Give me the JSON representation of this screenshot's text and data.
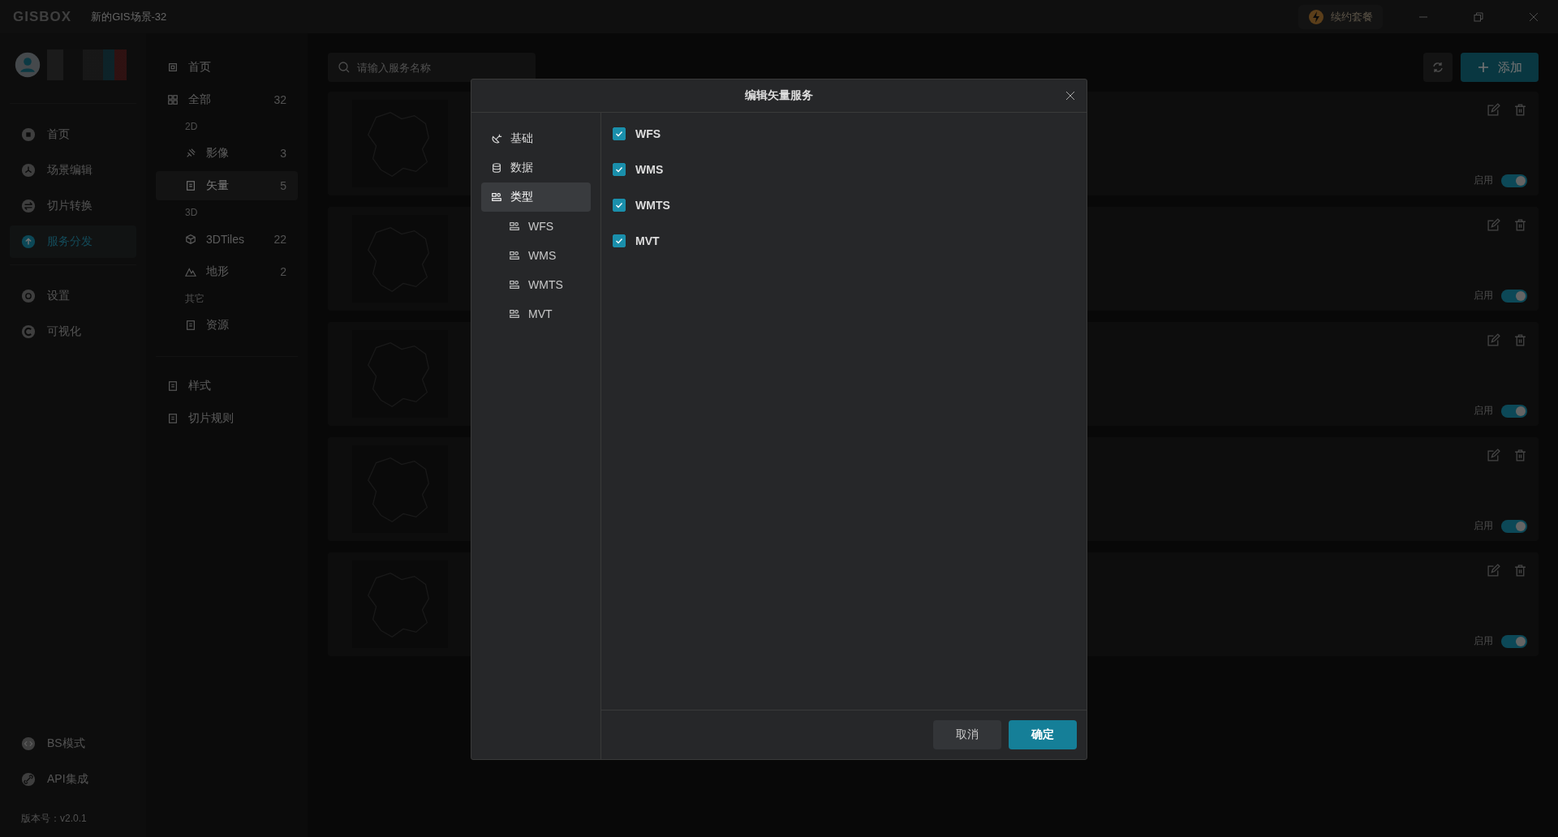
{
  "title_bar": {
    "logo": "GISBOX",
    "scene_title": "新的GIS场景-32",
    "renew_button": "续约套餐"
  },
  "nav": {
    "items": [
      {
        "label": "首页",
        "selected": false
      },
      {
        "label": "场景编辑",
        "selected": false
      },
      {
        "label": "切片转换",
        "selected": false
      },
      {
        "label": "服务分发",
        "selected": true
      }
    ],
    "secondary_items": [
      {
        "label": "设置"
      },
      {
        "label": "可视化"
      }
    ],
    "bottom_items": [
      {
        "label": "BS模式"
      },
      {
        "label": "API集成"
      }
    ],
    "version": "版本号：v2.0.1"
  },
  "categories": {
    "top": [
      {
        "label": "首页"
      },
      {
        "label": "全部",
        "count": "32"
      }
    ],
    "groups": [
      {
        "heading": "2D",
        "items": [
          {
            "label": "影像",
            "count": "3",
            "selected": false
          },
          {
            "label": "矢量",
            "count": "5",
            "selected": true
          }
        ]
      },
      {
        "heading": "3D",
        "items": [
          {
            "label": "3DTiles",
            "count": "22",
            "selected": false
          },
          {
            "label": "地形",
            "count": "2",
            "selected": false
          }
        ]
      },
      {
        "heading": "其它",
        "items": [
          {
            "label": "资源",
            "selected": false
          }
        ]
      }
    ],
    "bottom": [
      {
        "label": "样式"
      },
      {
        "label": "切片规则"
      }
    ]
  },
  "toolbar": {
    "search": {
      "placeholder": "请输入服务名称"
    },
    "add_button": "添加"
  },
  "services": [
    {
      "status_label": "启用",
      "enabled": true
    },
    {
      "status_label": "启用",
      "enabled": true
    },
    {
      "status_label": "启用",
      "enabled": true
    },
    {
      "status_label": "启用",
      "enabled": true
    },
    {
      "status_label": "启用",
      "enabled": true
    }
  ],
  "dialog": {
    "title": "编辑矢量服务",
    "menu": [
      {
        "label": "基础",
        "selected": false
      },
      {
        "label": "数据",
        "selected": false
      },
      {
        "label": "类型",
        "selected": true,
        "children": [
          {
            "label": "WFS"
          },
          {
            "label": "WMS"
          },
          {
            "label": "WMTS"
          },
          {
            "label": "MVT"
          }
        ]
      }
    ],
    "options": [
      {
        "label": "WFS",
        "checked": true
      },
      {
        "label": "WMS",
        "checked": true
      },
      {
        "label": "WMTS",
        "checked": true
      },
      {
        "label": "MVT",
        "checked": true
      }
    ],
    "buttons": [
      {
        "label": "取消",
        "kind": "secondary"
      },
      {
        "label": "确定",
        "kind": "primary"
      }
    ]
  }
}
